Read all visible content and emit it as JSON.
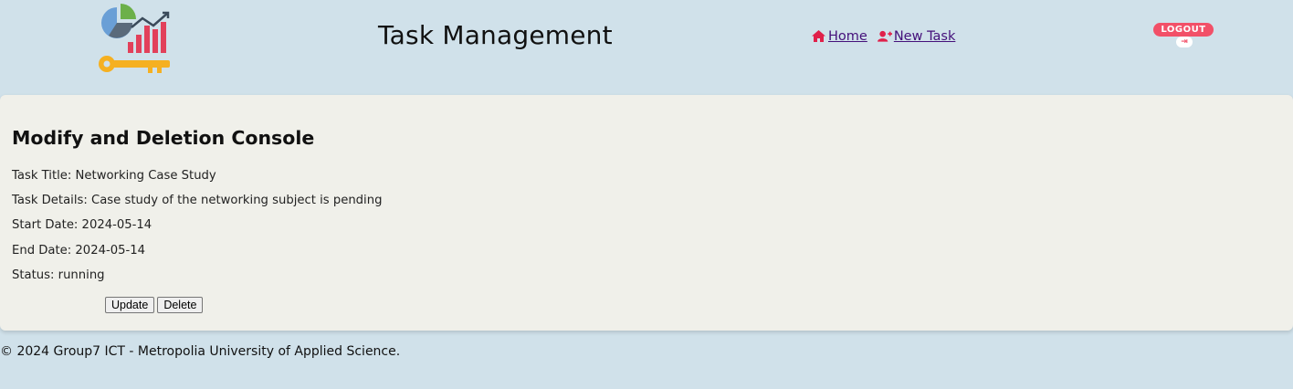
{
  "header": {
    "title": "Task Management",
    "nav": [
      {
        "label": " Home",
        "icon": "home-icon"
      },
      {
        "label": " New Task",
        "icon": "user-plus-icon"
      }
    ],
    "logout_label": "LOGOUT",
    "logout_icon": "sign-out-icon"
  },
  "console": {
    "heading": "Modify and Deletion Console",
    "task_title": "Task Title: Networking Case Study",
    "task_details": "Task Details: Case study of the networking subject is pending",
    "start_date": "Start Date: 2024-05-14",
    "end_date": "End Date: 2024-05-14",
    "status": "Status: running",
    "update_label": "Update",
    "delete_label": "Delete"
  },
  "footer": {
    "text": "© 2024 Group7 ICT - Metropolia University of Applied Science."
  },
  "colors": {
    "page_bg": "#d0e1ea",
    "panel_bg": "#f0f0ea",
    "nav_link": "#44107a",
    "accent_red": "#f25068"
  }
}
